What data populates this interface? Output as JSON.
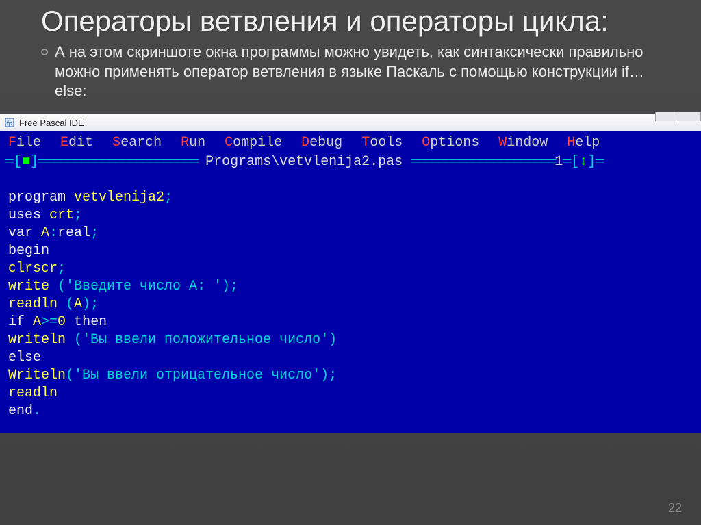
{
  "slide": {
    "title": "Операторы ветвления и операторы цикла:",
    "bullet": "А на этом скриншоте окна программы можно увидеть, как синтаксически правильно можно применять оператор ветвления в языке Паскаль с помощью конструкции if…else:",
    "page_number": "22"
  },
  "window": {
    "title": "Free Pascal IDE",
    "icon_label": "fp-icon"
  },
  "ide": {
    "menu": [
      {
        "hot": "F",
        "rest": "ile"
      },
      {
        "hot": "E",
        "rest": "dit"
      },
      {
        "hot": "S",
        "rest": "earch"
      },
      {
        "hot": "R",
        "rest": "un"
      },
      {
        "hot": "C",
        "rest": "ompile"
      },
      {
        "hot": "D",
        "rest": "ebug"
      },
      {
        "hot": "T",
        "rest": "ools"
      },
      {
        "hot": "O",
        "rest": "ptions"
      },
      {
        "hot": "W",
        "rest": "indow"
      },
      {
        "hot": "H",
        "rest": "elp"
      }
    ],
    "file_header": {
      "left_decor": "═[",
      "left_box": "■",
      "left_decor2": "]═",
      "dashes_left": "══════════════════════",
      "filename": " Programs\\vetvlenija2.pas ",
      "dashes_right": "═════════════════════",
      "right_num": "1",
      "right_decor": "═[",
      "arrow": "↕",
      "right_decor2": "]═"
    },
    "code": {
      "l1_a": "program ",
      "l1_b": "vetvlenija2",
      "l1_c": ";",
      "l2_a": "uses ",
      "l2_b": "crt",
      "l2_c": ";",
      "l3_a": "var ",
      "l3_b": "A",
      "l3_c": ":",
      "l3_d": "real",
      "l3_e": ";",
      "l4_a": "begin",
      "l5_a": "clrscr",
      "l5_b": ";",
      "l6_a": "write ",
      "l6_b": "('Введите число A: ');",
      "l7_a": "readln ",
      "l7_b": "(",
      "l7_c": "A",
      "l7_d": ");",
      "l8_a": "if ",
      "l8_b": "A",
      "l8_c": ">=",
      "l8_d": "0",
      "l8_e": " then",
      "l9_a": "writeln ",
      "l9_b": "('Вы ввели положительное число')",
      "l10_a": "else",
      "l11_a": "Writeln",
      "l11_b": "('Вы ввели отрицательное число');",
      "l12_a": "readln",
      "l13_a": "end",
      "l13_b": "."
    }
  }
}
